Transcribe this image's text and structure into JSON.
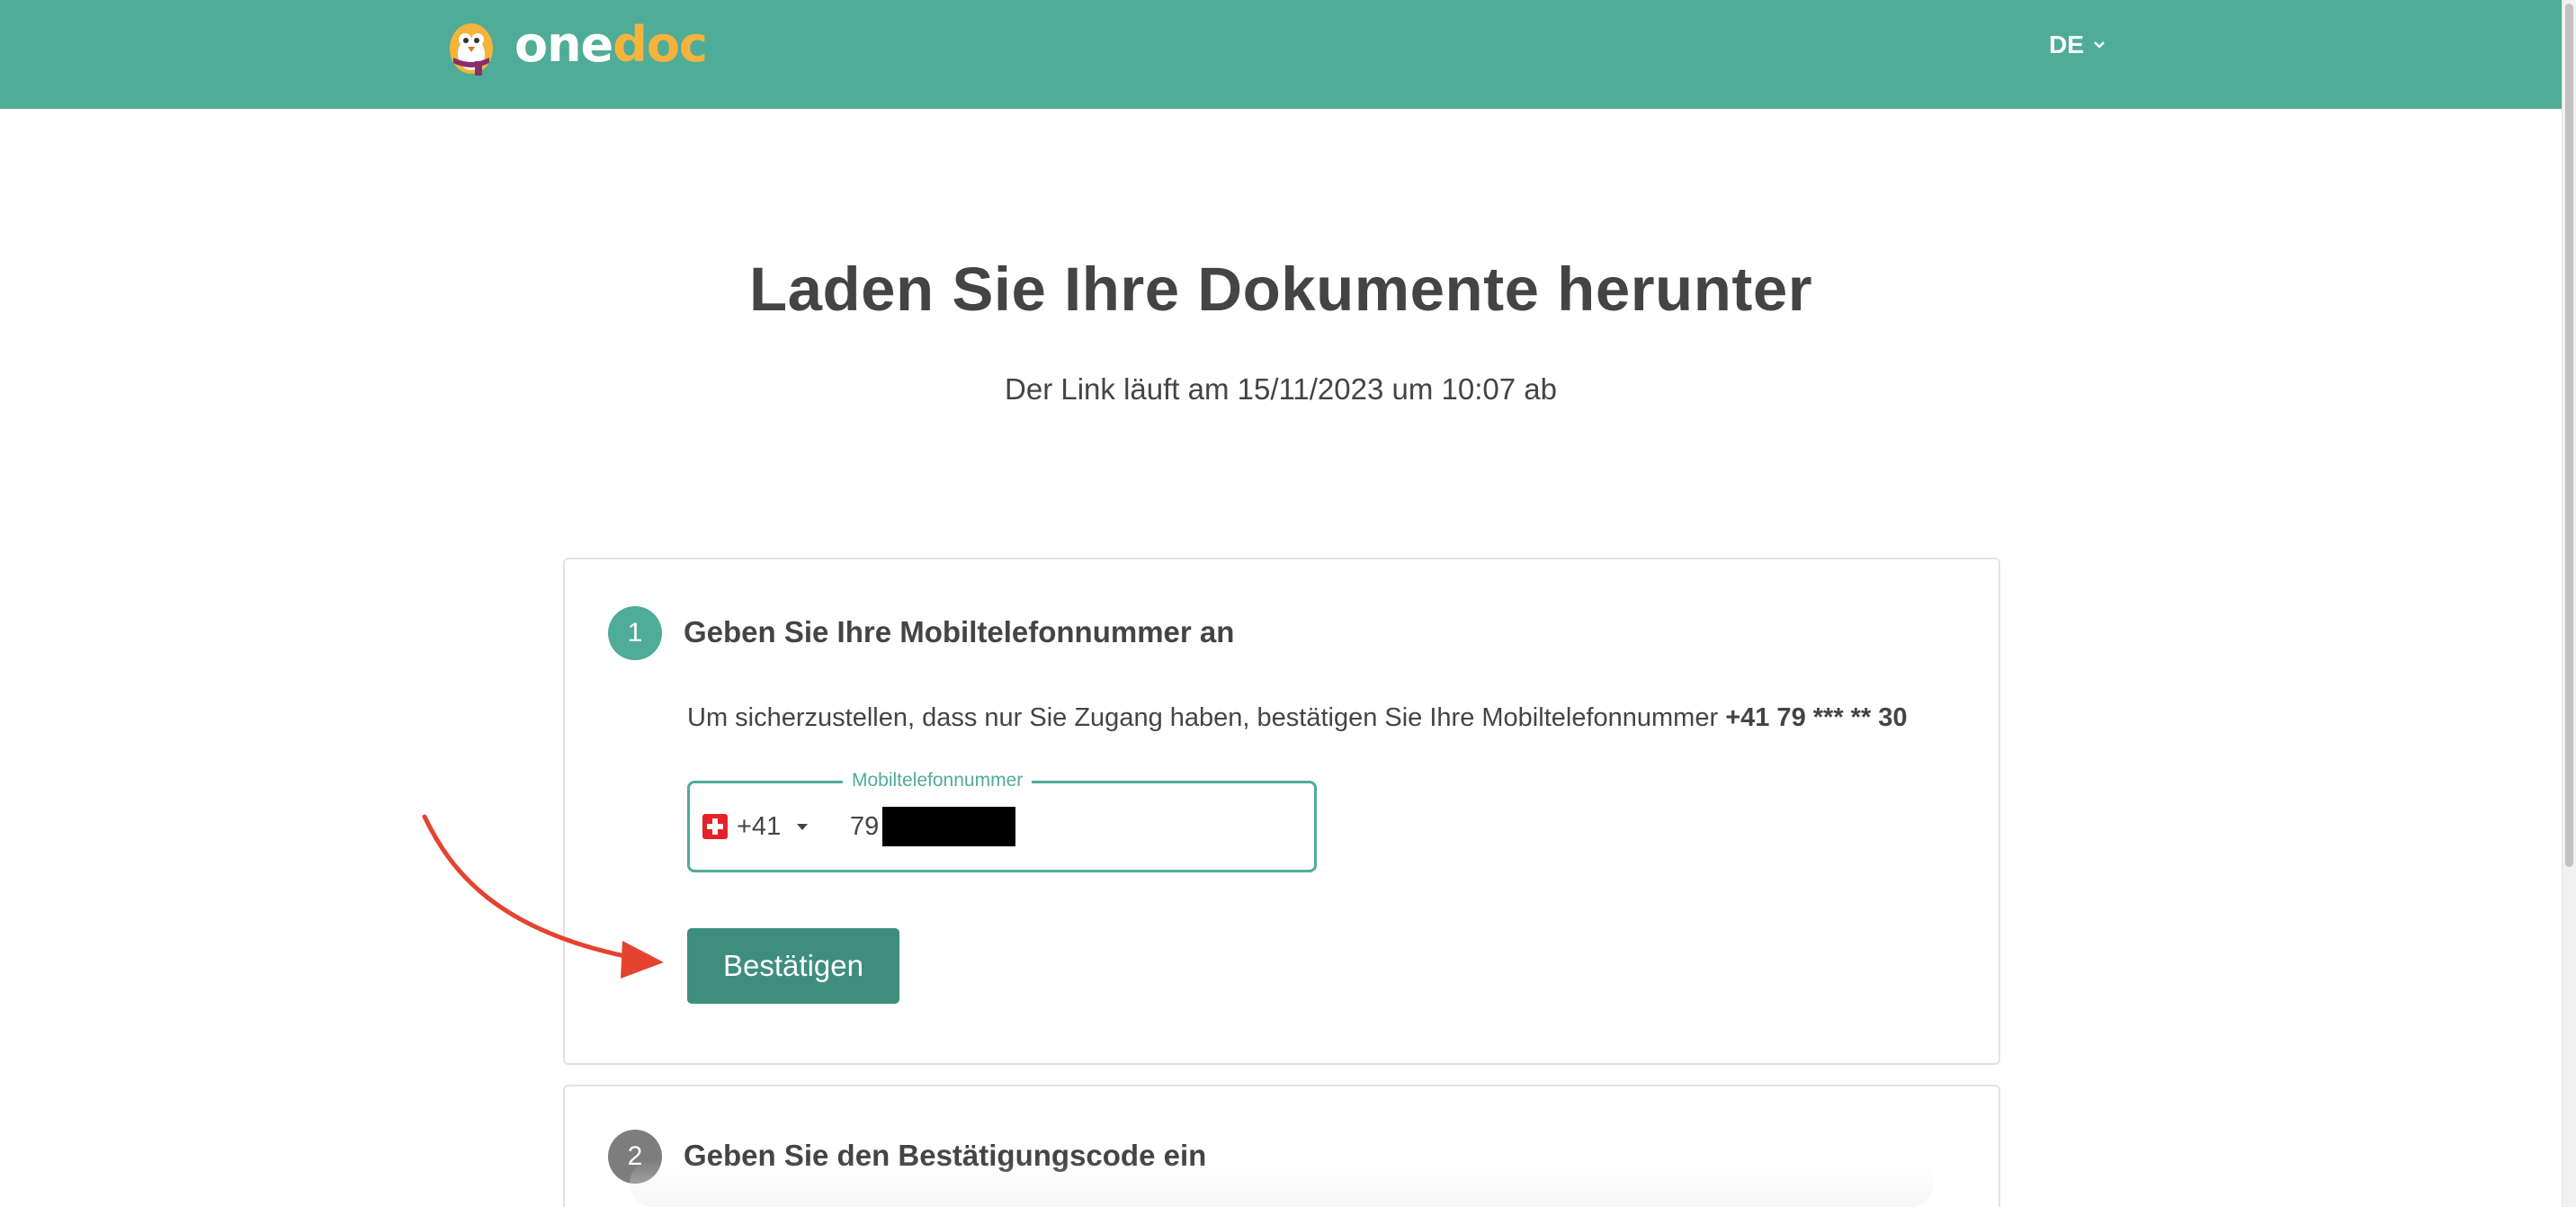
{
  "header": {
    "brand_one": "one",
    "brand_doc": "doc",
    "language": "DE",
    "logo_icon": "penguin-mascot-icon",
    "language_icon": "chevron-down-icon",
    "background_color": "#4fac98",
    "brand_accent_color": "#f6b33b"
  },
  "page": {
    "title": "Laden Sie Ihre Dokumente herunter",
    "subtitle": "Der Link läuft am 15/11/2023 um 10:07 ab"
  },
  "step1": {
    "number": "1",
    "title": "Geben Sie Ihre Mobiltelefonnummer an",
    "instruction": "Um sicherzustellen, dass nur Sie Zugang haben, bestätigen Sie Ihre Mobiltelefonnummer",
    "masked_number": "+41 79 *** ** 30",
    "phone_field": {
      "label": "Mobiltelefonnummer",
      "country_flag": "swiss-flag-icon",
      "dial_code": "+41",
      "value_visible": "79"
    },
    "confirm_label": "Bestätigen"
  },
  "step2": {
    "number": "2",
    "title": "Geben Sie den Bestätigungscode ein"
  },
  "colors": {
    "accent": "#4fac98",
    "button": "#3e8e7e",
    "inactive_step": "#7d7d7d",
    "annotation": "#e5432f"
  }
}
